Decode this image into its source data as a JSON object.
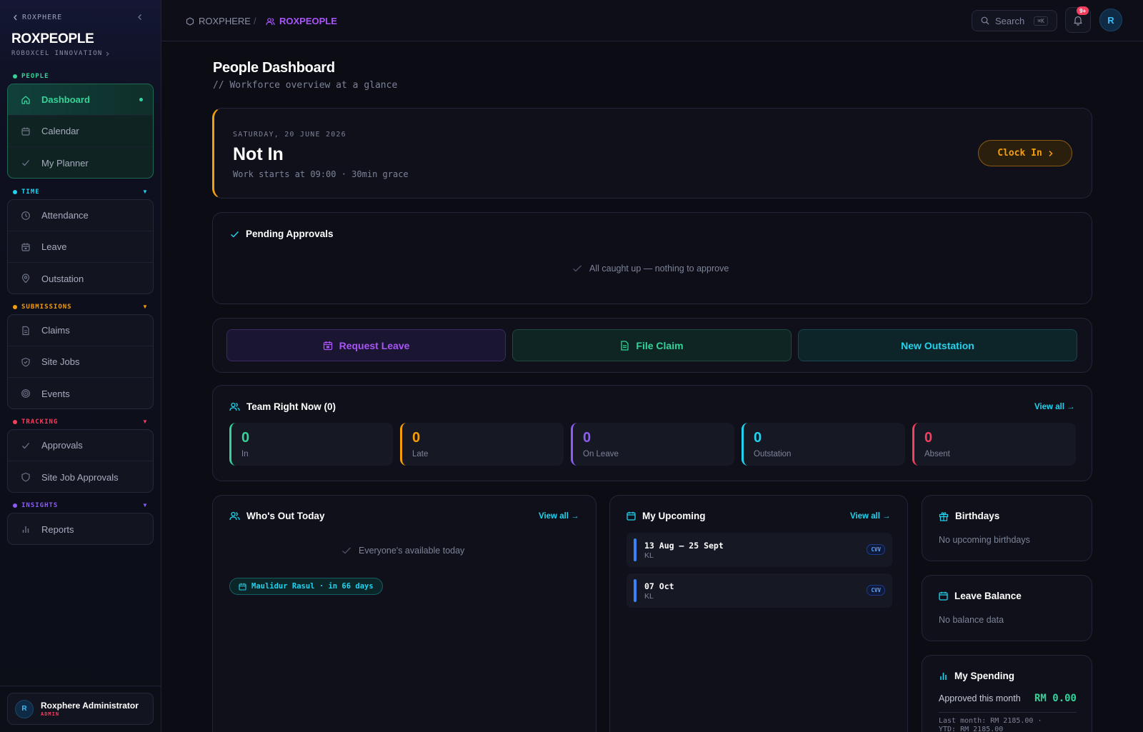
{
  "sidebar": {
    "back_label": "ROXPHERE",
    "app_title": "ROXPEOPLE",
    "org_name": "ROBOXCEL INNOVATION",
    "sections": {
      "people": {
        "label": "PEOPLE",
        "color": "#34d399"
      },
      "time": {
        "label": "TIME",
        "color": "#22d3ee"
      },
      "submissions": {
        "label": "SUBMISSIONS",
        "color": "#f59e0b"
      },
      "tracking": {
        "label": "TRACKING",
        "color": "#f43f5e"
      },
      "insights": {
        "label": "INSIGHTS",
        "color": "#8b5cf6"
      }
    },
    "items": {
      "dashboard": "Dashboard",
      "calendar": "Calendar",
      "planner": "My Planner",
      "attendance": "Attendance",
      "leave": "Leave",
      "outstation": "Outstation",
      "claims": "Claims",
      "site_jobs": "Site Jobs",
      "events": "Events",
      "approvals": "Approvals",
      "site_job_approvals": "Site Job Approvals",
      "reports": "Reports"
    },
    "user": {
      "initial": "R",
      "name": "Roxphere Administrator",
      "role": "ADMIN"
    }
  },
  "topbar": {
    "crumb_root": "ROXPHERE",
    "crumb_separator": "/",
    "crumb_current": "ROXPEOPLE",
    "search_label": "Search",
    "search_shortcut": "⌘K",
    "notification_badge": "9+",
    "avatar_initial": "R"
  },
  "page": {
    "title": "People Dashboard",
    "subtitle": "// Workforce overview at a glance"
  },
  "clock": {
    "date": "SATURDAY, 20 JUNE 2026",
    "status": "Not In",
    "note": "Work starts at 09:00 · 30min grace",
    "button": "Clock In",
    "accent": "#f59e0b"
  },
  "approvals": {
    "title": "Pending Approvals",
    "empty": "All caught up — nothing to approve"
  },
  "actions": {
    "request_leave": "Request Leave",
    "file_claim": "File Claim",
    "new_outstation": "New Outstation"
  },
  "team": {
    "title": "Team Right Now (0)",
    "view_all": "View all →",
    "stats": [
      {
        "value": "0",
        "label": "In",
        "color": "#34d399"
      },
      {
        "value": "0",
        "label": "Late",
        "color": "#f59e0b"
      },
      {
        "value": "0",
        "label": "On Leave",
        "color": "#8b5cf6"
      },
      {
        "value": "0",
        "label": "Outstation",
        "color": "#22d3ee"
      },
      {
        "value": "0",
        "label": "Absent",
        "color": "#f43f5e"
      }
    ]
  },
  "whos_out": {
    "title": "Who's Out Today",
    "view_all": "View all →",
    "empty": "Everyone's available today",
    "holiday": "Maulidur Rasul · in 66 days"
  },
  "upcoming": {
    "title": "My Upcoming",
    "view_all": "View all →",
    "items": [
      {
        "date": "13 Aug — 25 Sept",
        "location": "KL",
        "tag": "CVV"
      },
      {
        "date": "07 Oct",
        "location": "KL",
        "tag": "CVV"
      }
    ]
  },
  "birthdays": {
    "title": "Birthdays",
    "empty": "No upcoming birthdays"
  },
  "leave_balance": {
    "title": "Leave Balance",
    "empty": "No balance data"
  },
  "spending": {
    "title": "My Spending",
    "approved_label": "Approved this month",
    "approved_value": "RM 0.00",
    "last_month": "Last month: RM 2185.00 ·",
    "ytd": "YTD: RM 2185.00"
  }
}
